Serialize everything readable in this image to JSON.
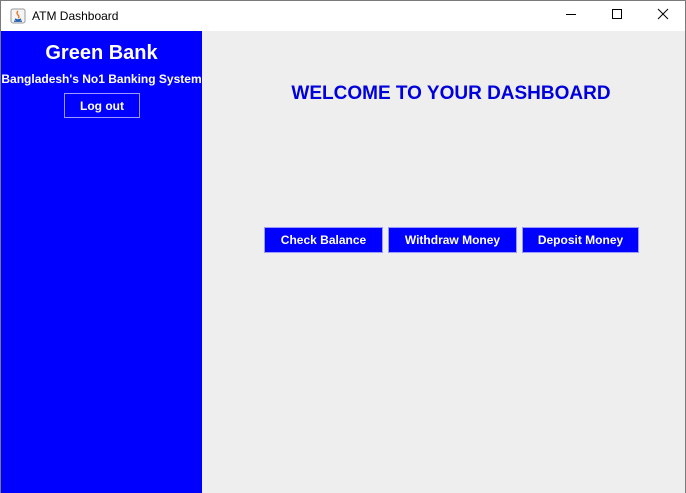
{
  "window": {
    "title": "ATM Dashboard",
    "icons": [
      "java-app-icon",
      "minimize-icon",
      "maximize-icon",
      "close-icon"
    ]
  },
  "sidebar": {
    "bank_name": "Green Bank",
    "tagline": "Bangladesh's No1 Banking System",
    "logout_label": "Log out",
    "background_color": "#0000ff"
  },
  "main": {
    "welcome_text": "WELCOME TO YOUR DASHBOARD",
    "welcome_color": "#0000dd",
    "background_color": "#eeeeee",
    "actions": [
      {
        "label": "Check Balance"
      },
      {
        "label": "Withdraw Money"
      },
      {
        "label": "Deposit Money"
      }
    ]
  }
}
